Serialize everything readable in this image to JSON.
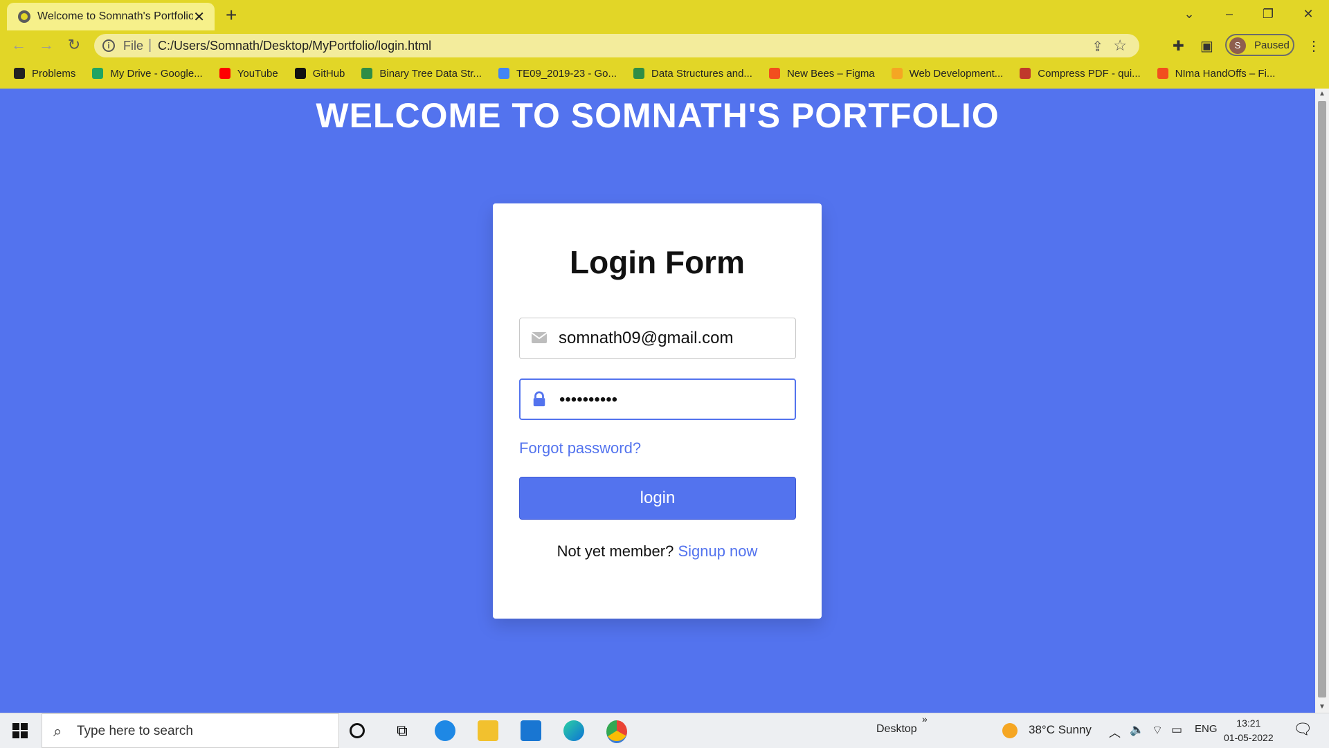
{
  "browser": {
    "tab_title": "Welcome to Somnath's Portfolio",
    "tab_close": "✕",
    "new_tab": "+",
    "scheme": "File",
    "url": "C:/Users/Somnath/Desktop/MyPortfolio/login.html",
    "profile_initial": "S",
    "profile_status": "Paused",
    "bookmarks": [
      {
        "label": "Problems",
        "icon": "leetcode-icon",
        "color": "#222222"
      },
      {
        "label": "My Drive - Google...",
        "icon": "google-drive-icon",
        "color": "#1fa463"
      },
      {
        "label": "YouTube",
        "icon": "youtube-icon",
        "color": "#ff0000"
      },
      {
        "label": "GitHub",
        "icon": "github-icon",
        "color": "#111111"
      },
      {
        "label": "Binary Tree Data Str...",
        "icon": "geeksforgeeks-icon",
        "color": "#2f8d46"
      },
      {
        "label": "TE09_2019-23 - Go...",
        "icon": "google-classroom-icon",
        "color": "#4285f4"
      },
      {
        "label": "Data Structures and...",
        "icon": "geeksforgeeks-icon",
        "color": "#2f8d46"
      },
      {
        "label": "New Bees – Figma",
        "icon": "figma-icon",
        "color": "#f24e1e"
      },
      {
        "label": "Web Development...",
        "icon": "web-dev-icon",
        "color": "#f5a623"
      },
      {
        "label": "Compress PDF - qui...",
        "icon": "pdf-icon",
        "color": "#c0392b"
      },
      {
        "label": "NImа HandOffs – Fi...",
        "icon": "figma-icon",
        "color": "#f24e1e"
      }
    ]
  },
  "page": {
    "heading": "WELCOME TO SOMNATH'S PORTFOLIO",
    "form": {
      "title": "Login Form",
      "email_value": "somnath09@gmail.com",
      "password_value": "••••••••••",
      "forgot_label": "Forgot password?",
      "login_label": "login",
      "signup_prompt": "Not yet member?",
      "signup_link": "Signup now"
    }
  },
  "taskbar": {
    "search_placeholder": "Type here to search",
    "desktop_label": "Desktop",
    "more_label": "»",
    "weather": "38°C  Sunny",
    "language": "ENG",
    "time": "13:21",
    "date": "01-05-2022"
  },
  "colors": {
    "accent": "#5373ee",
    "chrome": "#e2d627",
    "card": "#ffffff"
  }
}
